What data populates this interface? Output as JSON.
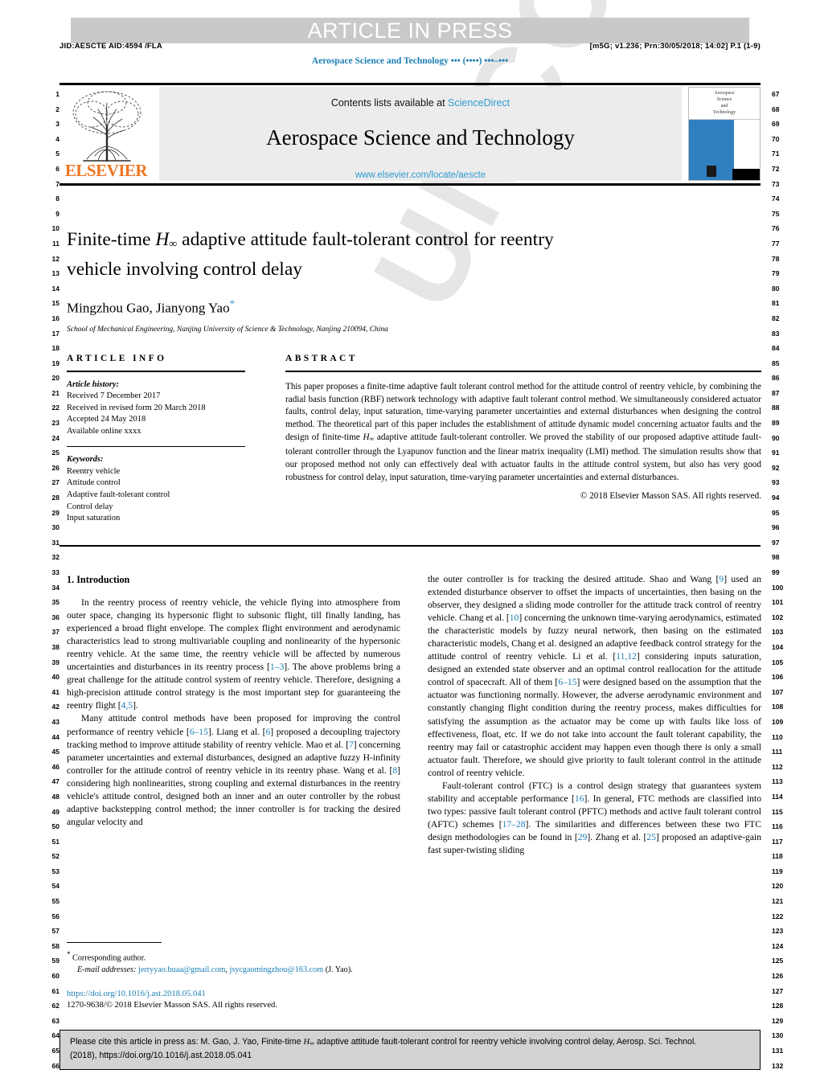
{
  "banner": {
    "text": "ARTICLE IN PRESS"
  },
  "meta": {
    "left": "JID:AESCTE   AID:4594 /FLA",
    "right": "[m5G; v1.236; Prn:30/05/2018; 14:02] P.1 (1-9)",
    "journal_running": "Aerospace Science and Technology ••• (••••) •••–•••"
  },
  "masthead": {
    "contents_prefix": "Contents lists available at ",
    "contents_link": "ScienceDirect",
    "journal_title": "Aerospace Science and Technology",
    "journal_url": "www.elsevier.com/locate/aescte",
    "publisher": "ELSEVIER",
    "cover_lines": [
      "Aerospace",
      "Science",
      "and",
      "Technology"
    ]
  },
  "title": {
    "line1_a": "Finite-time ",
    "line1_math": "H",
    "line1_sub": "∞",
    "line1_b": " adaptive attitude fault-tolerant control for reentry",
    "line2": "vehicle involving control delay"
  },
  "authors": {
    "names": "Mingzhou Gao, Jianyong Yao",
    "star": "*",
    "affiliation": "School of Mechanical Engineering, Nanjing University of Science & Technology, Nanjing 210094, China"
  },
  "article_info": {
    "heading": "ARTICLE INFO",
    "history_label": "Article history:",
    "history": [
      "Received 7 December 2017",
      "Received in revised form 20 March 2018",
      "Accepted 24 May 2018",
      "Available online xxxx"
    ],
    "keywords_label": "Keywords:",
    "keywords": [
      "Reentry vehicle",
      "Attitude control",
      "Adaptive fault-tolerant control",
      "Control delay",
      "Input saturation"
    ]
  },
  "abstract": {
    "heading": "ABSTRACT",
    "part1": "This paper proposes a finite-time adaptive fault tolerant control method for the attitude control of reentry vehicle, by combining the radial basis function (RBF) network technology with adaptive fault tolerant control method. We simultaneously considered actuator faults, control delay, input saturation, time-varying parameter uncertainties and external disturbances when designing the control method. The theoretical part of this paper includes the establishment of attitude dynamic model concerning actuator faults and the design of finite-time ",
    "math": "H",
    "math_sub": "∞",
    "part2": " adaptive attitude fault-tolerant controller. We proved the stability of our proposed adaptive attitude fault-tolerant controller through the Lyapunov function and the linear matrix inequality (LMI) method. The simulation results show that our proposed method not only can effectively deal with actuator faults in the attitude control system, but also has very good robustness for control delay, input saturation, time-varying parameter uncertainties and external disturbances.",
    "copyright": "© 2018 Elsevier Masson SAS. All rights reserved."
  },
  "body": {
    "section_heading": "1. Introduction",
    "left_p1": "In the reentry process of reentry vehicle, the vehicle flying into atmosphere from outer space, changing its hypersonic flight to subsonic flight, till finally landing, has experienced a broad flight envelope. The complex flight environment and aerodynamic characteristics lead to strong multivariable coupling and nonlinearity of the hypersonic reentry vehicle. At the same time, the reentry vehicle will be affected by numerous uncertainties and disturbances in its reentry process [1–3]. The above problems bring a great challenge for the attitude control system of reentry vehicle. Therefore, designing a high-precision attitude control strategy is the most important step for guaranteeing the reentry flight [4,5].",
    "left_p2": "Many attitude control methods have been proposed for improving the control performance of reentry vehicle [6–15]. Liang et al. [6] proposed a decoupling trajectory tracking method to improve attitude stability of reentry vehicle. Mao et al. [7] concerning parameter uncertainties and external disturbances, designed an adaptive fuzzy H-infinity controller for the attitude control of reentry vehicle in its reentry phase. Wang et al. [8] considering high nonlinearities, strong coupling and external disturbances in the reentry vehicle's attitude control, designed both an inner and an outer controller by the robust adaptive backstepping control method; the inner controller is for tracking the desired angular velocity and",
    "right_p1": "the outer controller is for tracking the desired attitude. Shao and Wang [9] used an extended disturbance observer to offset the impacts of uncertainties, then basing on the observer, they designed a sliding mode controller for the attitude track control of reentry vehicle. Chang et al. [10] concerning the unknown time-varying aerodynamics, estimated the characteristic models by fuzzy neural network, then basing on the estimated characteristic models, Chang et al. designed an adaptive feedback control strategy for the attitude control of reentry vehicle. Li et al. [11,12] considering inputs saturation, designed an extended state observer and an optimal control reallocation for the attitude control of spacecraft. All of them [6–15] were designed based on the assumption that the actuator was functioning normally. However, the adverse aerodynamic environment and constantly changing flight condition during the reentry process, makes difficulties for satisfying the assumption as the actuator may be come up with faults like loss of effectiveness, float, etc. If we do not take into account the fault tolerant capability, the reentry may fail or catastrophic accident may happen even though there is only a small actuator fault. Therefore, we should give priority to fault tolerant control in the attitude control of reentry vehicle.",
    "right_p2": "Fault-tolerant control (FTC) is a control design strategy that guarantees system stability and acceptable performance [16]. In general, FTC methods are classified into two types: passive fault tolerant control (PFTC) methods and active fault tolerant control (AFTC) schemes [17–28]. The similarities and differences between these two FTC design methodologies can be found in [29]. Zhang et al. [25] proposed an adaptive-gain fast super-twisting sliding"
  },
  "footnote": {
    "corresponding_star": "*",
    "corresponding_text": "Corresponding author.",
    "email_label": "E-mail addresses:",
    "email1": "jerryyao.buaa@gmail.com",
    "email_sep": ", ",
    "email2": "jsycgaomingzhou@163.com",
    "email_suffix": " (J. Yao).",
    "doi": "https://doi.org/10.1016/j.ast.2018.05.041",
    "imprint": "1270-9638/© 2018 Elsevier Masson SAS. All rights reserved."
  },
  "cite_box": {
    "prefix": "Please cite this article in press as: M. Gao, J. Yao, Finite-time ",
    "math": "H",
    "math_sub": "∞",
    "suffix": " adaptive attitude fault-tolerant control for reentry vehicle involving control delay, Aerosp. Sci. Technol.",
    "line2": "(2018), https://doi.org/10.1016/j.ast.2018.05.041"
  },
  "gutter": {
    "left_start": 1,
    "left_end": 66,
    "right_start": 67,
    "right_end": 132
  },
  "watermark": {
    "text": "UNCORRECTED PROOF"
  },
  "colors": {
    "link": "#1a7fb5",
    "elsevier_orange": "#ee7523",
    "banner_gray": "#c9c9c9",
    "masthead_gray": "#ececec",
    "cite_box_gray": "#d3d3d3"
  }
}
